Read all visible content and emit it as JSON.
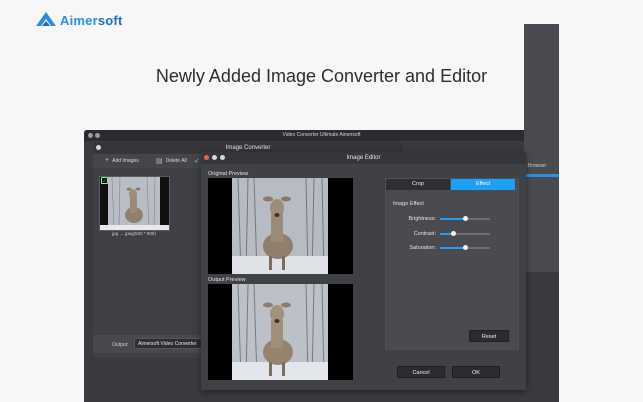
{
  "brand": {
    "name_part1": "Aimer",
    "name_part2": "soft",
    "colors": {
      "blue": "#2a8fe0",
      "dark": "#2f7fc4"
    }
  },
  "headline": "Newly Added Image Converter and Editor",
  "app": {
    "title": "Video Converter Ultimate Aimersoft",
    "right_panel_label": "s Browser"
  },
  "converter": {
    "title": "Image Converter",
    "add_images": "Add Images",
    "delete_all": "Delete All",
    "thumbnail_caption": "jpg → jpeg(500 * 500)",
    "output_label": "Output:",
    "output_value": "Aimersoft Video Converter"
  },
  "editor": {
    "title": "Image Editor",
    "original_preview": "Original Preview",
    "output_preview": "Output Preview",
    "tabs": [
      {
        "label": "Crop",
        "active": false
      },
      {
        "label": "Effect",
        "active": true
      }
    ],
    "effect_section": "Image Effect",
    "sliders": [
      {
        "label": "Brightness:",
        "value": 0.5
      },
      {
        "label": "Contrast:",
        "value": 0.25
      },
      {
        "label": "Saturation:",
        "value": 0.5
      }
    ],
    "reset": "Reset",
    "cancel": "Cancel",
    "ok": "OK",
    "accent": "#1aa0f5"
  }
}
